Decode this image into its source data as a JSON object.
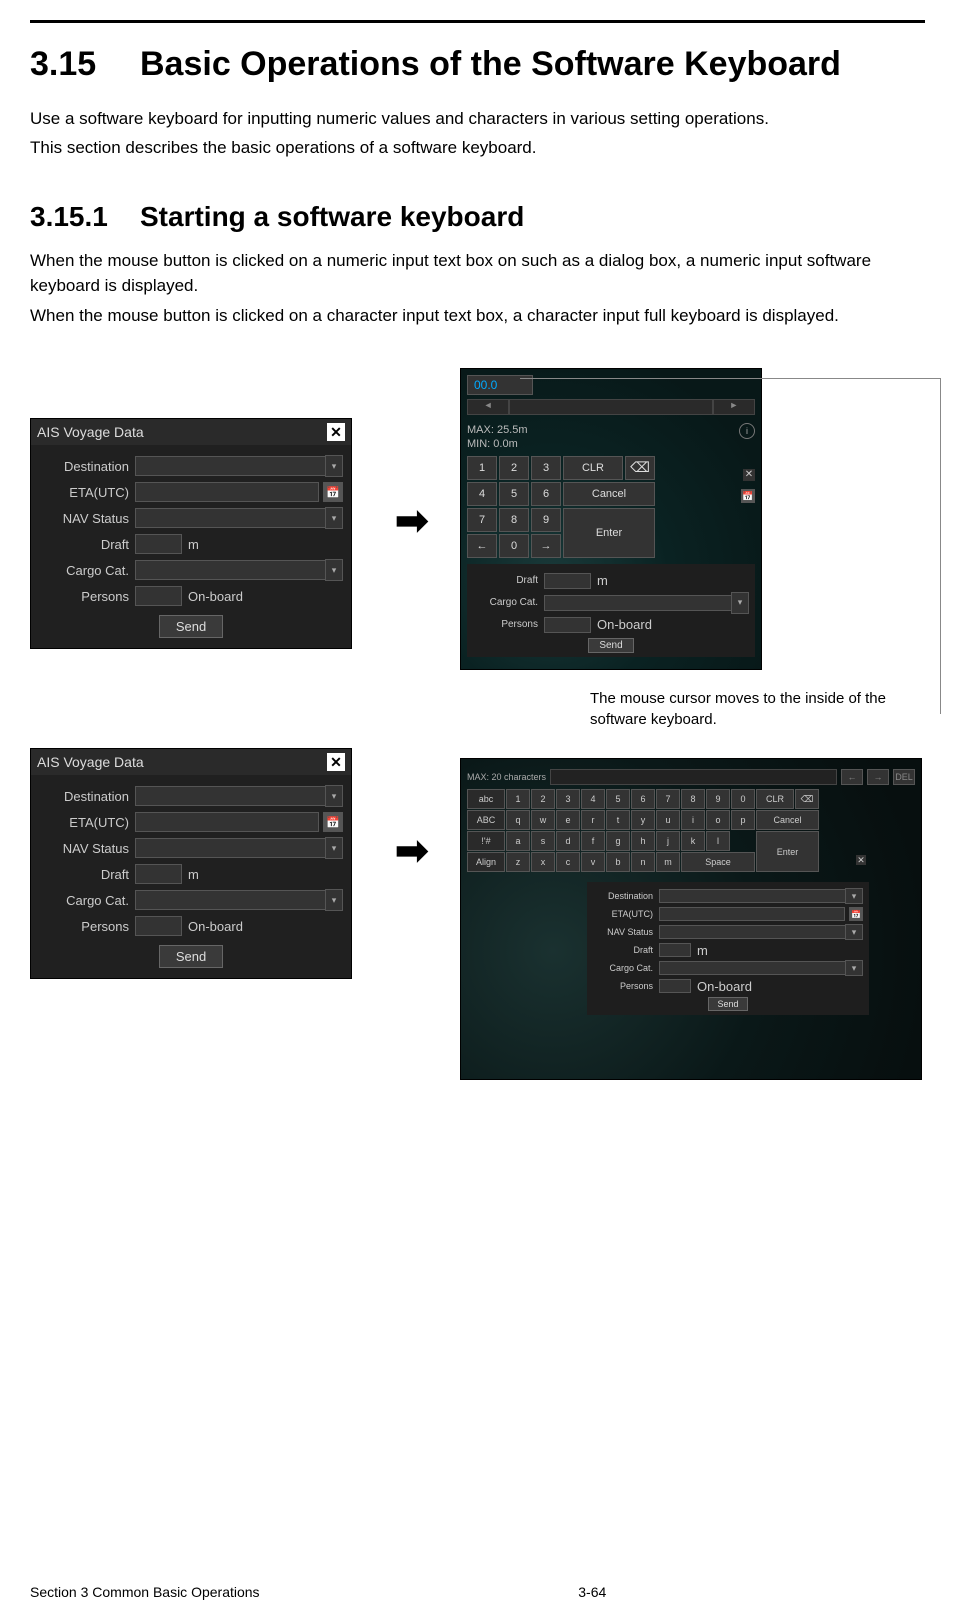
{
  "heading": {
    "number": "3.15",
    "title": "Basic Operations of the Software Keyboard"
  },
  "intro": {
    "p1": "Use a software keyboard for inputting numeric values and characters in various setting operations.",
    "p2": "This section describes the basic operations of a software keyboard."
  },
  "sub": {
    "number": "3.15.1",
    "title": "Starting a software keyboard",
    "p1": "When the mouse button is clicked on a numeric input text box on such as a dialog box, a numeric input software keyboard is displayed.",
    "p2": "When the mouse button is clicked on a character input text box, a character input full keyboard is displayed."
  },
  "dialog": {
    "title": "AIS Voyage Data",
    "fields": {
      "destination": "Destination",
      "eta": "ETA(UTC)",
      "nav": "NAV Status",
      "draft": "Draft",
      "draft_unit": "m",
      "cargo": "Cargo Cat.",
      "persons": "Persons",
      "persons_suffix": "On-board"
    },
    "send": "Send"
  },
  "numpad": {
    "display": "00.0",
    "max": "MAX: 25.5m",
    "min": "MIN: 0.0m",
    "keys": {
      "1": "1",
      "2": "2",
      "3": "3",
      "4": "4",
      "5": "5",
      "6": "6",
      "7": "7",
      "8": "8",
      "9": "9",
      "0": "0",
      "clr": "CLR",
      "cancel": "Cancel",
      "enter": "Enter",
      "left": "←",
      "right": "→",
      "bksp": "⌫"
    }
  },
  "charkbd": {
    "max_label": "MAX: 20 characters",
    "nav": {
      "left": "←",
      "right": "→",
      "del": "DEL"
    },
    "modes": {
      "abc": "abc",
      "ABC": "ABC",
      "sym": "!'#",
      "align": "Align"
    },
    "row_num": [
      "1",
      "2",
      "3",
      "4",
      "5",
      "6",
      "7",
      "8",
      "9",
      "0"
    ],
    "row1": [
      "q",
      "w",
      "e",
      "r",
      "t",
      "y",
      "u",
      "i",
      "o",
      "p"
    ],
    "row2": [
      "a",
      "s",
      "d",
      "f",
      "g",
      "h",
      "j",
      "k",
      "l"
    ],
    "row3": [
      "z",
      "x",
      "c",
      "v",
      "b",
      "n",
      "m"
    ],
    "clr": "CLR",
    "bksp": "⌫",
    "cancel": "Cancel",
    "enter": "Enter",
    "space": "Space"
  },
  "annotation": "The mouse cursor moves to the inside of the software keyboard.",
  "footer": {
    "left": "Section 3    Common Basic Operations",
    "center": "3-64"
  }
}
